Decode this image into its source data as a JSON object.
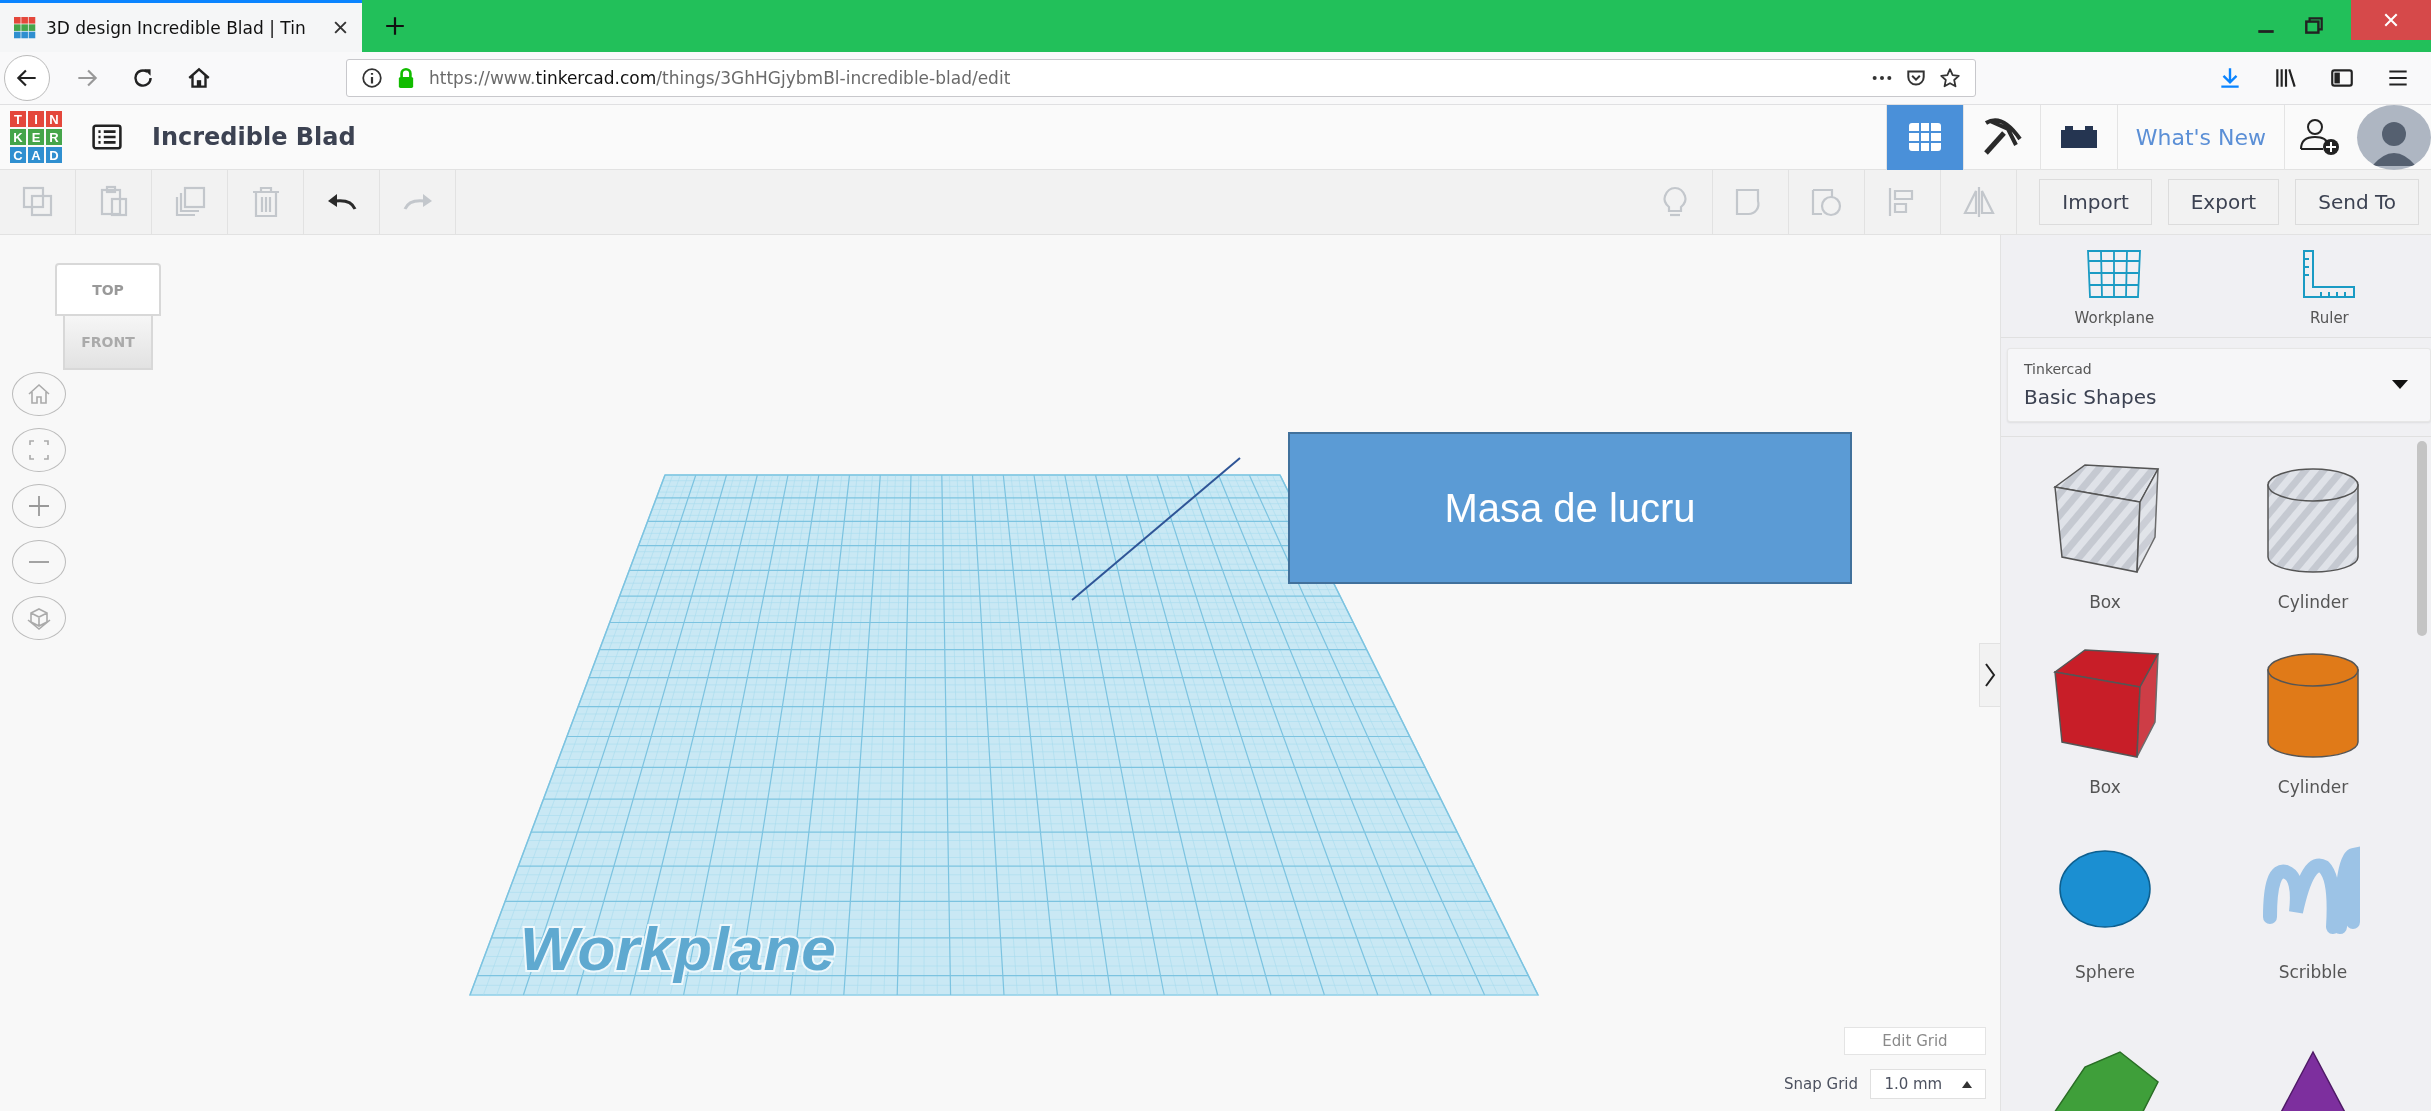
{
  "browser": {
    "tab_title": "3D design Incredible Blad | Tin",
    "url": {
      "scheme": "https://www.",
      "domain": "tinkercad.com",
      "path": "/things/3GhHGjybmBl-incredible-blad/edit"
    }
  },
  "logo": {
    "rows": [
      {
        "letters": [
          "T",
          "I",
          "N"
        ],
        "color": "#e4473b"
      },
      {
        "letters": [
          "K",
          "E",
          "R"
        ],
        "color": "#45a54a"
      },
      {
        "letters": [
          "C",
          "A",
          "D"
        ],
        "color": "#2f8fd0"
      }
    ]
  },
  "header": {
    "title": "Incredible Blad",
    "views": [
      {
        "kind": "grid",
        "selected": true
      },
      {
        "kind": "pickaxe",
        "selected": false
      },
      {
        "kind": "bricks",
        "selected": false
      }
    ],
    "whats_new": "What's New"
  },
  "toolbar": {
    "left": [
      {
        "kind": "copy",
        "disabled": true
      },
      {
        "kind": "paste",
        "disabled": true
      },
      {
        "kind": "duplicate",
        "disabled": true
      },
      {
        "kind": "delete",
        "disabled": true
      },
      {
        "kind": "undo",
        "disabled": false
      },
      {
        "kind": "redo",
        "disabled": true
      }
    ],
    "right": [
      {
        "kind": "note",
        "disabled": true
      },
      {
        "kind": "group",
        "disabled": true
      },
      {
        "kind": "ungroup",
        "disabled": true
      },
      {
        "kind": "align",
        "disabled": true
      },
      {
        "kind": "mirror",
        "disabled": true
      }
    ],
    "actions": [
      "Import",
      "Export",
      "Send To"
    ]
  },
  "view_cube": {
    "top": "TOP",
    "front": "FRONT"
  },
  "workplane": {
    "label": "Workplane"
  },
  "callout": {
    "text": "Masa de lucru"
  },
  "grid_controls": {
    "edit_grid": "Edit Grid",
    "snap_label": "Snap Grid",
    "snap_value": "1.0 mm"
  },
  "panel": {
    "tools": [
      "Workplane",
      "Ruler"
    ],
    "library": {
      "source": "Tinkercad",
      "category": "Basic Shapes"
    },
    "shapes": [
      {
        "name": "Box",
        "kind": "box-hole"
      },
      {
        "name": "Cylinder",
        "kind": "cylinder-hole"
      },
      {
        "name": "Box",
        "kind": "box",
        "color": "#c81e28"
      },
      {
        "name": "Cylinder",
        "kind": "cylinder",
        "color": "#e07a18"
      },
      {
        "name": "Sphere",
        "kind": "sphere",
        "color": "#1b8fd2"
      },
      {
        "name": "Scribble",
        "kind": "scribble",
        "color": "#9cc3e6"
      },
      {
        "kind": "roof",
        "color": "#3f9f3a"
      },
      {
        "kind": "cone",
        "color": "#7d2f9e"
      }
    ]
  }
}
